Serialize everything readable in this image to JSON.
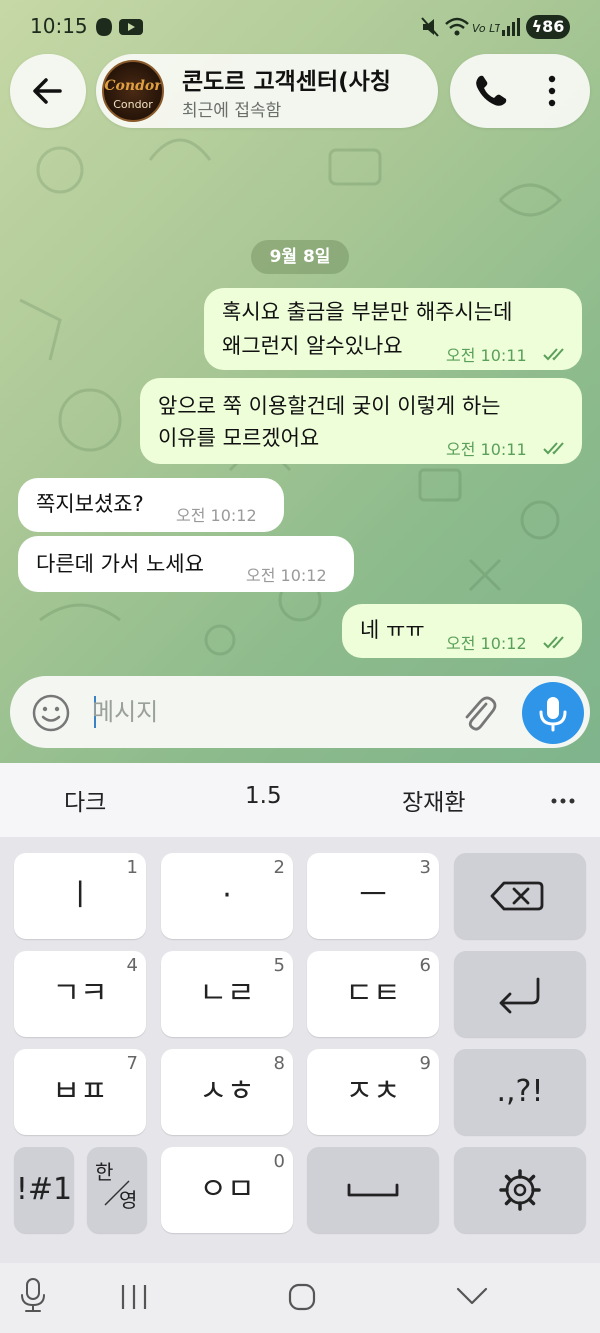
{
  "status_bar": {
    "time": "10:15",
    "battery": "86"
  },
  "header": {
    "title": "콘도르 고객센터(사칭",
    "subtitle": "최근에 접속함",
    "avatar_top": "Condor",
    "avatar_bottom": "Condor"
  },
  "date_chip": "9월 8일",
  "messages": [
    {
      "direction": "out",
      "lines": [
        "혹시요 출금을 부분만 해주시는데",
        "왜그런지 알수있나요"
      ],
      "time": "오전 10:11"
    },
    {
      "direction": "out",
      "lines": [
        "앞으로 쭉 이용할건데 궂이 이렇게 하는",
        "이유를 모르겠어요"
      ],
      "time": "오전 10:11"
    },
    {
      "direction": "in",
      "lines": [
        "쪽지보셨죠?"
      ],
      "time": "오전 10:12"
    },
    {
      "direction": "in",
      "lines": [
        "다른데 가서 노세요"
      ],
      "time": "오전 10:12"
    },
    {
      "direction": "out",
      "lines": [
        "네 ㅠㅠ"
      ],
      "time": "오전 10:12"
    }
  ],
  "composer": {
    "placeholder": "메시지"
  },
  "keyboard": {
    "suggestions": [
      "다크",
      "1.5",
      "장재환"
    ],
    "rows": [
      [
        {
          "label": "ㅣ",
          "num": "1"
        },
        {
          "label": "·",
          "num": "2"
        },
        {
          "label": "ㅡ",
          "num": "3"
        }
      ],
      [
        {
          "label": "ㄱㅋ",
          "num": "4"
        },
        {
          "label": "ㄴㄹ",
          "num": "5"
        },
        {
          "label": "ㄷㅌ",
          "num": "6"
        }
      ],
      [
        {
          "label": "ㅂㅍ",
          "num": "7"
        },
        {
          "label": "ㅅㅎ",
          "num": "8"
        },
        {
          "label": "ㅈㅊ",
          "num": "9"
        }
      ]
    ],
    "punct_label": ".,?!",
    "symbols_label": "!#1",
    "lang_han": "한",
    "lang_eng": "영",
    "key_0_label": "ㅇㅁ",
    "key_0_num": "0"
  },
  "colors": {
    "accent": "#2f95e8",
    "outgoing_bubble": "#eefed9",
    "read_check": "#5aa05a"
  }
}
